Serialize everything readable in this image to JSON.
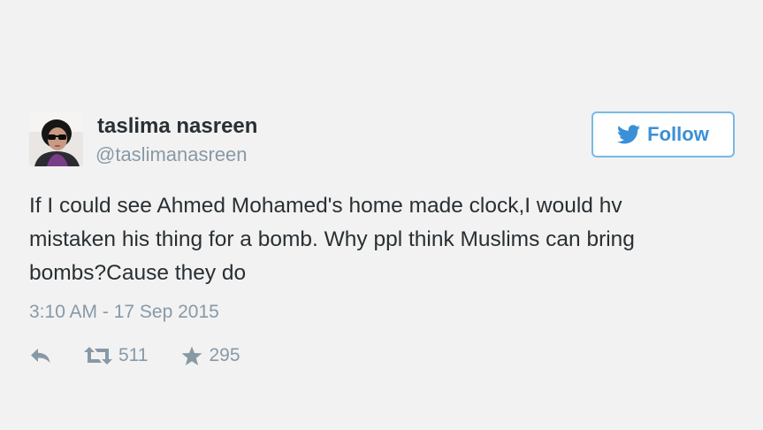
{
  "tweet": {
    "author": {
      "display_name": "taslima nasreen",
      "screen_name": "@taslimanasreen",
      "avatar_icon": "profile-photo"
    },
    "follow_button": {
      "label": "Follow",
      "icon": "twitter-bird-icon"
    },
    "text_lines": [
      "If I could see Ahmed Mohamed's home made clock,I would hv",
      "mistaken his thing for a bomb. Why ppl think Muslims can bring",
      "bombs?Cause they do"
    ],
    "timestamp": "3:10 AM - 17 Sep 2015",
    "actions": {
      "reply_icon": "reply-arrow-icon",
      "retweet_icon": "retweet-icon",
      "retweet_count": "511",
      "favorite_icon": "star-icon",
      "favorite_count": "295"
    },
    "colors": {
      "background": "#f2f2f2",
      "text": "#292f33",
      "muted": "#8899a6",
      "accent": "#3a90d6",
      "button_border": "#78b9e6"
    }
  }
}
